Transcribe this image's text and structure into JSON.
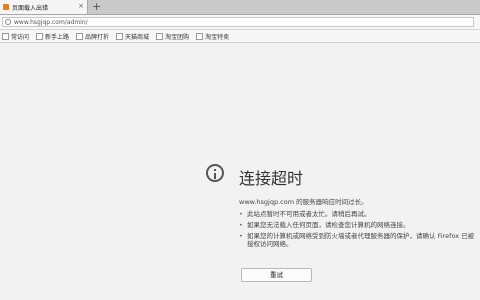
{
  "tab": {
    "title": "页面载入出错",
    "close_glyph": "×",
    "new_tab_glyph": "+"
  },
  "address": {
    "url": "www.hsgjqp.com/admin/"
  },
  "bookmarks": [
    {
      "label": "常访问"
    },
    {
      "label": "新手上路"
    },
    {
      "label": "品牌打折"
    },
    {
      "label": "天猫商城"
    },
    {
      "label": "淘宝团购"
    },
    {
      "label": "淘宝特卖"
    }
  ],
  "error": {
    "title": "连接超时",
    "description": "www.hsgjqp.com 的服务器响应时间过长。",
    "items": [
      "此站点暂时不可用或者太忙。请稍后再试。",
      "如果您无法载入任何页面，请检查您计算机的网络连接。",
      "如果您的计算机或网络受到防火墙或者代理服务器的保护，请确认 Firefox 已被授权访问网络。"
    ],
    "retry_label": "重试"
  },
  "colors": {
    "page_bg": "#f2f2f2",
    "tab_bar": "#c9c9c9",
    "text": "#333333"
  }
}
